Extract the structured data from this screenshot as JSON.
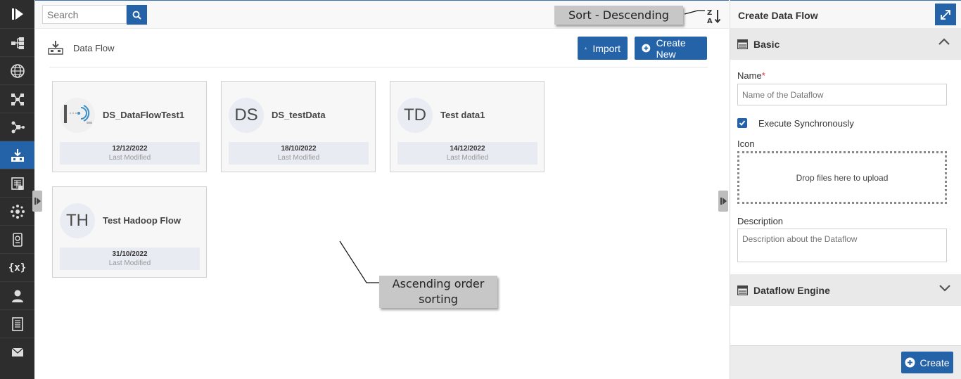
{
  "rail": {
    "items": [
      {
        "name": "rail-item-hierarchy",
        "icon": "hierarchy-icon"
      },
      {
        "name": "rail-item-globe",
        "icon": "globe-icon"
      },
      {
        "name": "rail-item-network",
        "icon": "network-icon"
      },
      {
        "name": "rail-item-flow",
        "icon": "flow-icon"
      },
      {
        "name": "rail-item-dataflow",
        "icon": "dataflow-icon",
        "active": true
      },
      {
        "name": "rail-item-report",
        "icon": "report-icon"
      },
      {
        "name": "rail-item-cluster",
        "icon": "cluster-icon"
      },
      {
        "name": "rail-item-mobile",
        "icon": "mobile-icon"
      },
      {
        "name": "rail-item-variables",
        "icon": "variables-icon",
        "label": "{x}"
      },
      {
        "name": "rail-item-user",
        "icon": "user-icon"
      },
      {
        "name": "rail-item-document",
        "icon": "document-icon"
      },
      {
        "name": "rail-item-mail",
        "icon": "mail-icon"
      }
    ]
  },
  "search": {
    "placeholder": "Search"
  },
  "section": {
    "title": "Data Flow"
  },
  "buttons": {
    "import": "Import",
    "create_new": "Create New"
  },
  "cards": [
    {
      "name": "DS_DataFlowTest1",
      "date": "12/12/2022",
      "meta_label": "Last Modified",
      "initials": ""
    },
    {
      "name": "DS_testData",
      "date": "18/10/2022",
      "meta_label": "Last Modified",
      "initials": "DS"
    },
    {
      "name": "Test data1",
      "date": "14/12/2022",
      "meta_label": "Last Modified",
      "initials": "TD"
    },
    {
      "name": "Test Hadoop Flow",
      "date": "31/10/2022",
      "meta_label": "Last Modified",
      "initials": "TH"
    }
  ],
  "panel": {
    "title": "Create Data Flow",
    "basic_label": "Basic",
    "name_label": "Name",
    "required_mark": "*",
    "name_placeholder": "Name of the Dataflow",
    "execute_label": "Execute Synchronously",
    "execute_checked": true,
    "icon_label": "Icon",
    "dropzone_text": "Drop files here to upload",
    "description_label": "Description",
    "description_placeholder": "Description about the Dataflow",
    "engine_label": "Dataflow Engine",
    "create_label": "Create"
  },
  "callouts": {
    "sort": "Sort - Descending",
    "ascending": "Ascending order sorting"
  },
  "colors": {
    "accent": "#2563a8",
    "rail": "#2d2d2d"
  }
}
